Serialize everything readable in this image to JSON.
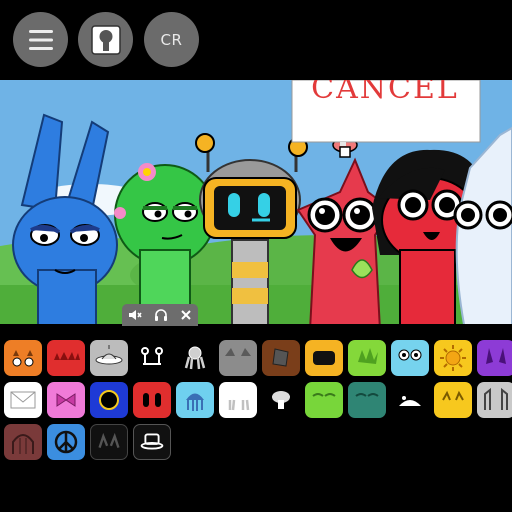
{
  "toolbar": {
    "menu_icon": "hamburger-menu-icon",
    "avatar_icon": "character-silhouette-icon",
    "credits_label": "CR"
  },
  "scene": {
    "sign_text": "CANCEL",
    "sky_color": "#6fb3e6",
    "grass_color": "#4fae3a"
  },
  "sound_tray": {
    "icons": [
      "mute-icon",
      "headphones-icon",
      "close-icon"
    ]
  },
  "palette": {
    "rows": [
      [
        "orange-crab",
        "red-spikes",
        "gray-ufo",
        "black-antenna",
        "gray-octopus",
        "gray-cat-ears",
        "brown-hat",
        "yellow-visor",
        "green-leaves",
        "cyan-frog",
        "yellow-sun",
        "purple-horns"
      ],
      [
        "white-envelope",
        "pink-bow",
        "blue-ring",
        "red-eyes",
        "cyan-jellyfish",
        "white-tears",
        "mushroom",
        "green-blob",
        "teal-blob",
        "black-ears",
        "yellow-cat",
        "gray-castle"
      ],
      [
        "brown-arch",
        "blue-peace",
        "black-claws",
        "black-hat"
      ]
    ]
  }
}
